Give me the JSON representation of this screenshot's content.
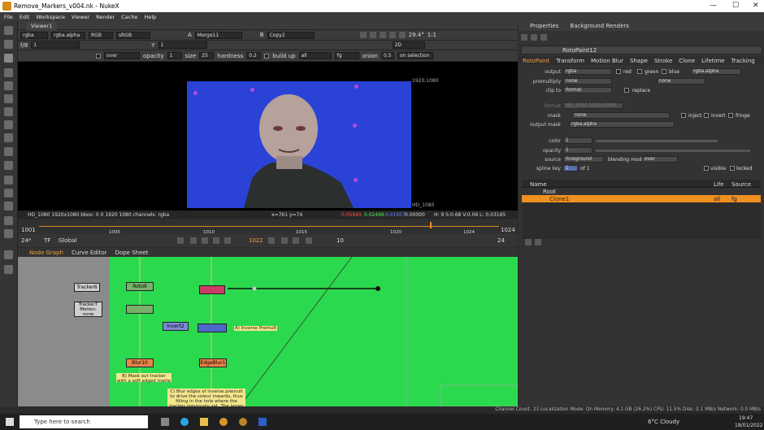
{
  "window": {
    "title": "Remove_Markers_v004.nk - NukeX",
    "controls": [
      "—",
      "☐",
      "✕"
    ]
  },
  "menu": [
    "File",
    "Edit",
    "Workspace",
    "Viewer",
    "Render",
    "Cache",
    "Help"
  ],
  "viewer": {
    "tab": "Viewer1",
    "channels": "rgba",
    "channel_sel": "rgba.alpha",
    "colorspace_mode": "RGB",
    "lut": "sRGB",
    "input_a_label": "A",
    "input_a": "Merge11",
    "input_b_label": "B",
    "input_b": "Copy2",
    "zoom": "29.4°",
    "scale": "1:1",
    "mode": "2D",
    "fstop": "f/8",
    "gain": "1",
    "gamma_label": "Y",
    "gamma": "1",
    "paint": {
      "blend": "over",
      "opacity_label": "opacity",
      "opacity": "1",
      "size_label": "size",
      "size": "25",
      "hardness_label": "hardness",
      "hardness": "0.2",
      "buildup": "build up",
      "output": "all",
      "channel": "fg",
      "onion_label": "onion",
      "onion": "0.5",
      "on_selection": "on selection"
    },
    "format_label": "1920,1080",
    "hd_label": "HD_1080",
    "info_left": "HD_1080 1920x1080  bbox: 0 0 1920 1080 channels: rgba",
    "info_xy": "x=761 y=74",
    "info_r": "0.05849",
    "info_g": "0.02496",
    "info_b": "0.01957",
    "info_a": "0.00000",
    "info_right": "H: 9 S:0.68 V:0.06  L: 0.03165"
  },
  "timeline": {
    "start": "1001",
    "end": "1024",
    "ticks": [
      "1005",
      "1010",
      "1015",
      "1020",
      "1024"
    ],
    "current": "1022",
    "fps": "24*",
    "tf": "TF",
    "range": "Global",
    "step": "10",
    "frames": "24"
  },
  "nodegraph": {
    "tabs": [
      "Node Graph",
      "Curve Editor",
      "Dope Sheet"
    ],
    "nodes": [
      "Tracker6",
      "Roto9",
      "Tracker7",
      "Invert2",
      "Blur10",
      "EdgeBlur1"
    ],
    "tracker7_note": "Motion: none",
    "note_a": "A) Inverse Premult",
    "note_b": "B) Mask out tracker with a soft edged matte",
    "note_c": "C) Blur edges of inverse premult to drive the colour inwards, thus filling in the hole where the tracker previously sat. The larger the .blur, the larger"
  },
  "properties": {
    "tabs": [
      "Properties",
      "Background Renders"
    ],
    "node_name": "RotoPaint12",
    "subtabs": [
      "RotoPaint",
      "Transform",
      "Motion Blur",
      "Shape",
      "Stroke",
      "Clone",
      "Lifetime",
      "Tracking"
    ],
    "output_label": "output",
    "output": "rgba",
    "red": "red",
    "green": "green",
    "blue": "blue",
    "alpha": "rgba.alpha",
    "premultiply_label": "premultiply",
    "premultiply": "none",
    "premult_b": "none",
    "clip_label": "clip to",
    "clip": "format",
    "replace": "replace",
    "format_label": "format",
    "format": "HD_1080 1920x1080",
    "mask_label": "mask",
    "mask": "none",
    "inject": "inject",
    "invert": "invert",
    "fringe": "fringe",
    "outmask_label": "output mask",
    "outmask": "rgba.alpha",
    "color_label": "color",
    "color": "1",
    "opacity_label": "opacity",
    "opacity": "1",
    "source_label": "source",
    "source": "foreground",
    "blend_label": "blending mode",
    "blend": "over",
    "spline_label": "spline key",
    "spline_key": "1",
    "of": "of 1",
    "visible": "visible",
    "locked": "locked",
    "columns": [
      "Name",
      "Life",
      "Source"
    ],
    "rows": [
      {
        "name": "Root",
        "life": "",
        "source": ""
      },
      {
        "name": "Clone1",
        "life": "all",
        "source": "fg"
      }
    ]
  },
  "status": "Channel Count: 23  Localization Mode: On  Memory: 4.1 GB (26.2%)  CPU: 11.5%  Disk: 0.1 MB/s  Network: 0.0 MB/s",
  "taskbar": {
    "search": "Type here to search",
    "weather": "6°C  Cloudy",
    "time": "19:47",
    "date": "18/01/2022"
  }
}
